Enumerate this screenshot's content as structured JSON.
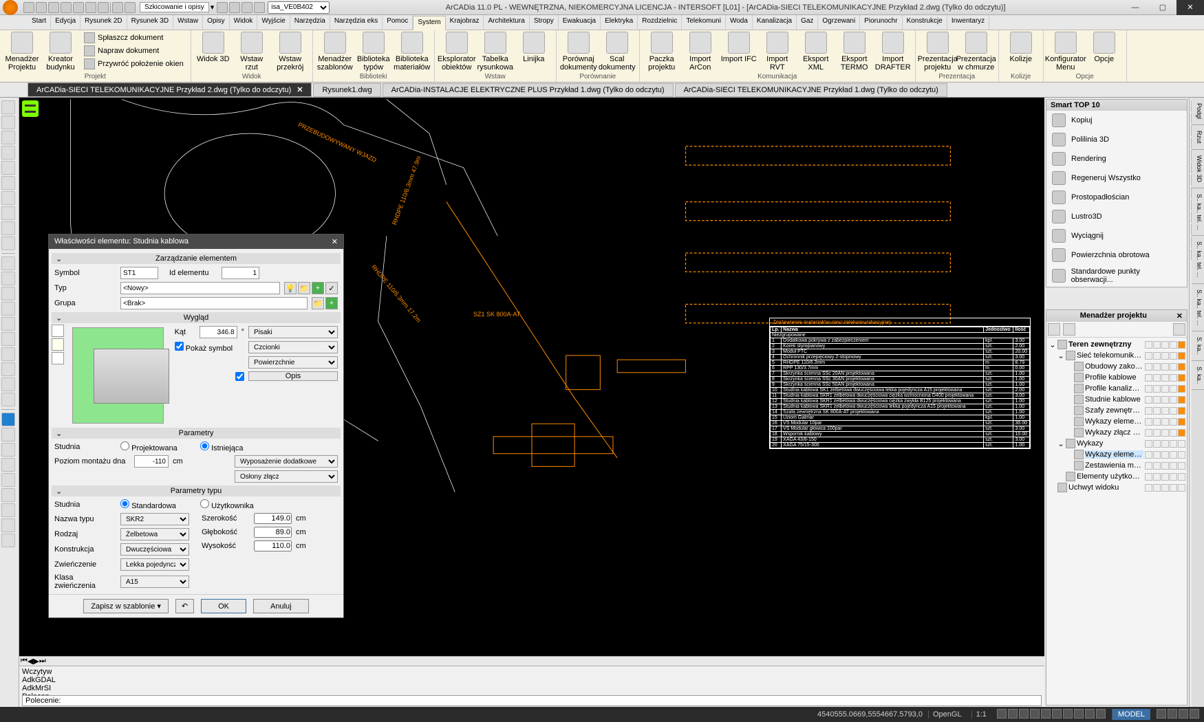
{
  "title": "ArCADia 11.0 PL - WEWNĘTRZNA, NIEKOMERCYJNA LICENCJA - INTERSOFT [L01] - [ArCADia-SIECI TELEKOMUNIKACYJNE Przykład 2.dwg (Tylko do odczytu)]",
  "qat_combo": "isa_VE0B402",
  "qat_label": "Szkicowanie i opisy",
  "ribbon_tabs": [
    "Start",
    "Edycja",
    "Rysunek 2D",
    "Rysunek 3D",
    "Wstaw",
    "Opisy",
    "Widok",
    "Wyjście",
    "Narzędzia",
    "Narzędzia eks",
    "Pomoc",
    "System",
    "Krajobraz",
    "Architektura",
    "Stropy",
    "Ewakuacja",
    "Elektryka",
    "Rozdzielnic",
    "Telekomuni",
    "Woda",
    "Kanalizacja",
    "Gaz",
    "Ogrzewani",
    "Piorunochr",
    "Konstrukcje",
    "Inwentaryz"
  ],
  "ribbon_active": 11,
  "ribbon": {
    "g1": {
      "label": "Projekt",
      "items": [
        "Menadżer Projektu",
        "Kreator budynku"
      ],
      "small": [
        "Spłaszcz dokument",
        "Napraw dokument",
        "Przywróć położenie okien"
      ]
    },
    "g2": {
      "label": "Widok",
      "items": [
        "Widok 3D",
        "Wstaw rzut",
        "Wstaw przekrój"
      ]
    },
    "g3": {
      "label": "Biblioteki",
      "items": [
        "Menadżer szablonów",
        "Biblioteka typów",
        "Biblioteka materiałów"
      ]
    },
    "g4": {
      "label": "Wstaw",
      "items": [
        "Eksplorator obiektów",
        "Tabelka rysunkowa",
        "Linijka"
      ]
    },
    "g5": {
      "label": "Porównanie",
      "items": [
        "Porównaj dokumenty",
        "Scal dokumenty"
      ]
    },
    "g6": {
      "label": "Komunikacja",
      "items": [
        "Paczka projektu",
        "Import ArCon",
        "Import IFC",
        "Import RVT",
        "Eksport XML",
        "Eksport TERMO",
        "Import DRAFTER"
      ]
    },
    "g7": {
      "label": "Prezentacja",
      "items": [
        "Prezentacja projektu",
        "Prezentacja w chmurze"
      ]
    },
    "g8": {
      "label": "Kolizje",
      "items": [
        "Kolizje"
      ]
    },
    "g9": {
      "label": "Opcje",
      "items": [
        "Konfigurator Menu",
        "Opcje"
      ]
    }
  },
  "doc_tabs": [
    {
      "label": "ArCADia-SIECI TELEKOMUNIKACYJNE Przykład 2.dwg (Tylko do odczytu)",
      "active": true
    },
    {
      "label": "Rysunek1.dwg"
    },
    {
      "label": "ArCADia-INSTALACJE ELEKTRYCZNE PLUS Przykład 1.dwg (Tylko do odczytu)"
    },
    {
      "label": "ArCADia-SIECI TELEKOMUNIKACYJNE Przykład 1.dwg (Tylko do odczytu)"
    }
  ],
  "canvas_labels": {
    "wjazd": "PRZEBUDOWYWANY WJAZD",
    "wany": "WANY",
    "sz1": "SZ1 SK 800A-AT",
    "rhdpe": "RHDPE 110/6.3mm 17.2m",
    "diam1": "RHDPE 110/6.3mm 47.9m"
  },
  "bom": {
    "title": "Zestawienie materiałów sieci telekomunikacyjnej",
    "headers": [
      "Lp.",
      "Nazwa",
      "Jednostwo",
      "Ilość"
    ],
    "group": "Niezgrupowane",
    "rows": [
      [
        "1",
        "Dodatkowa pokrywa z zabezpieczeniem",
        "kpl.",
        "3.00"
      ],
      [
        "2",
        "Korek styropianowy",
        "szt.",
        "2.00"
      ],
      [
        "3",
        "Moduł PTC",
        "szt.",
        "20.00"
      ],
      [
        "4",
        "Ochronnik przepięciowy 2-stopniowy",
        "szt.",
        "3.00"
      ],
      [
        "5",
        "RHDPE 110/6.3mm",
        "m",
        "8.79"
      ],
      [
        "6",
        "RPP 130/3.7mm",
        "m",
        "0.00"
      ],
      [
        "7",
        "Skrzynka ścienna SSc 20AN projektowana",
        "szt.",
        "1.00"
      ],
      [
        "8",
        "Skrzynka ścienna SSc 30AN projektowana",
        "szt.",
        "1.00"
      ],
      [
        "9",
        "Skrzynka ścienna SSc 50AN projektowana",
        "szt.",
        "1.00"
      ],
      [
        "10",
        "Studnia kablowa SK1 żelbetowa dwuczęściowa lekka pojedyncza A15 projektowana",
        "szt.",
        "2.00"
      ],
      [
        "11",
        "Studnia kablowa SKR1 żelbetowa dwuczęściowa ciężka wzmocniona D400 projektowana",
        "szt.",
        "3.00"
      ],
      [
        "12",
        "Studnia kablowa SKR1 żelbetowa dwuczęściowa ciężka zwykła B125 projektowana",
        "szt.",
        "1.00"
      ],
      [
        "13",
        "Studnia kablowa SKR1 żelbetowa dwuczęściowa lekka pojedyncza A15 projektowana",
        "szt.",
        "1.00"
      ],
      [
        "14",
        "Szafa zewnętrzna SK 800A-AT projektowana",
        "szt.",
        "1.00"
      ],
      [
        "15",
        "Uziom Galmar",
        "kpl.",
        "1.00"
      ],
      [
        "16",
        "VS Modular 10par",
        "szt.",
        "30.00"
      ],
      [
        "17",
        "VS Modular głowica 100par",
        "szt.",
        "3.00"
      ],
      [
        "18",
        "Wspornik kablowy",
        "szt.",
        "10.00"
      ],
      [
        "19",
        "XAGA 43/8-150",
        "szt.",
        "3.00"
      ],
      [
        "20",
        "XAGA 75/15-300",
        "szt.",
        "1.00"
      ]
    ]
  },
  "smart_top10": {
    "title": "Smart TOP 10",
    "items": [
      "Kopiuj",
      "Polilinia 3D",
      "Rendering",
      "Regeneruj Wszystko",
      "Prostopadłościan",
      "Lustro3D",
      "Wyciągnij",
      "Powierzchnia obrotowa",
      "Standardowe punkty obserwacji..."
    ]
  },
  "projmgr": {
    "title": "Menadżer projektu",
    "tree": [
      {
        "indent": 0,
        "toggle": "⌄",
        "label": "Teren zewnętrzny",
        "bold": true,
        "orange": true
      },
      {
        "indent": 1,
        "toggle": "⌄",
        "label": "Sieć telekomunikacyjna",
        "orange": true
      },
      {
        "indent": 2,
        "label": "Obudowy zakończeń linio...",
        "orange": true
      },
      {
        "indent": 2,
        "label": "Profile kablowe",
        "orange": true
      },
      {
        "indent": 2,
        "label": "Profile kanalizacji pierwotnej",
        "orange": true
      },
      {
        "indent": 2,
        "label": "Studnie kablowe",
        "orange": true
      },
      {
        "indent": 2,
        "label": "Szafy zewnętrzne",
        "orange": true
      },
      {
        "indent": 2,
        "label": "Wykazy elementów profili",
        "orange": true
      },
      {
        "indent": 2,
        "label": "Wykazy złącz w obiektach",
        "orange": true
      },
      {
        "indent": 1,
        "toggle": "⌄",
        "label": "Wykazy"
      },
      {
        "indent": 2,
        "label": "Wykazy elementów sieci te...",
        "selected": true
      },
      {
        "indent": 2,
        "label": "Zestawienia materiałów sie..."
      },
      {
        "indent": 1,
        "label": "Elementy użytkownika"
      },
      {
        "indent": 0,
        "label": "Uchwyt widoku"
      }
    ]
  },
  "dialog": {
    "title": "Właściwości elementu: Studnia kablowa",
    "sec1": "Zarządzanie elementem",
    "symbol_lbl": "Symbol",
    "symbol": "ST1",
    "id_lbl": "Id elementu",
    "id": "1",
    "typ_lbl": "Typ",
    "typ": "<Nowy>",
    "grupa_lbl": "Grupa",
    "grupa": "<Brak>",
    "sec2": "Wygląd",
    "kat_lbl": "Kąt",
    "kat": "346.8",
    "kat_unit": "°",
    "pokaz": "Pokaż symbol",
    "pisaki": "Pisaki",
    "czcionki": "Czcionki",
    "powierzchnie": "Powierzchnie",
    "opis": "Opis",
    "sec3": "Parametry",
    "studnia_lbl": "Studnia",
    "proj": "Projektowana",
    "istn": "Istniejąca",
    "poziom_lbl": "Poziom montażu dna",
    "poziom": "-110",
    "cm": "cm",
    "wyposazenie": "Wyposażenie dodatkowe",
    "oslony": "Osłony złącz",
    "sec4": "Parametry typu",
    "studnia2_lbl": "Studnia",
    "standard": "Standardowa",
    "uzytk": "Użytkownika",
    "nazwa_lbl": "Nazwa typu",
    "nazwa": "SKR2",
    "rodzaj_lbl": "Rodzaj",
    "rodzaj": "Żelbetowa",
    "konstr_lbl": "Konstrukcja",
    "konstr": "Dwuczęściowa",
    "zwien_lbl": "Zwieńczenie",
    "zwien": "Lekka pojedyncza",
    "klasa_lbl": "Klasa zwieńczenia",
    "klasa": "A15",
    "szer_lbl": "Szerokość",
    "szer": "149.0",
    "gleb_lbl": "Głębokość",
    "gleb": "89.0",
    "wys_lbl": "Wysokość",
    "wys": "110.0",
    "zapisz": "Zapisz w szablonie",
    "ok": "OK",
    "anuluj": "Anuluj"
  },
  "cmd_history": [
    "Wczytyw",
    "AdkGDAL",
    "AdkMrSI",
    "Polecen"
  ],
  "cmd_prompt": "Polecenie:",
  "status": {
    "coords": "4540555.0669,5554667.5793,0",
    "opengl": "OpenGL",
    "scale": "1:1",
    "model": "MODEL"
  },
  "side_tabs": [
    "Podgl",
    "Rzut",
    "Widok 3D",
    "S.. ka.. tel. ...",
    "S.. ka.. tel. ...",
    "S.. ka.. tel. ...",
    "S. ka..",
    "S. ka.."
  ]
}
